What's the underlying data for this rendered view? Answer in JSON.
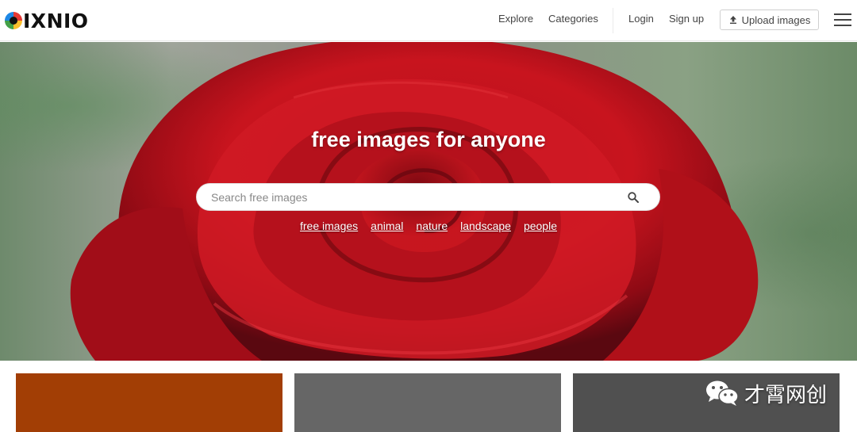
{
  "header": {
    "logo_text": "IXNIO",
    "nav": {
      "explore": "Explore",
      "categories": "Categories",
      "login": "Login",
      "signup": "Sign up",
      "upload": "Upload images"
    }
  },
  "hero": {
    "title": "free images for anyone",
    "search": {
      "placeholder": "Search free images",
      "value": ""
    },
    "tags": [
      "free images",
      "animal",
      "nature",
      "landscape",
      "people"
    ]
  },
  "watermark": {
    "text": "才霄网创"
  },
  "colors": {
    "card_1": "#a23e05",
    "card_2": "#666666",
    "card_3": "#505050",
    "rose": "#c8141e"
  },
  "icons": {
    "logo": "pixnio-logo-icon",
    "upload": "upload-icon",
    "menu": "hamburger-menu-icon",
    "search": "search-icon",
    "watermark": "wechat-icon"
  }
}
